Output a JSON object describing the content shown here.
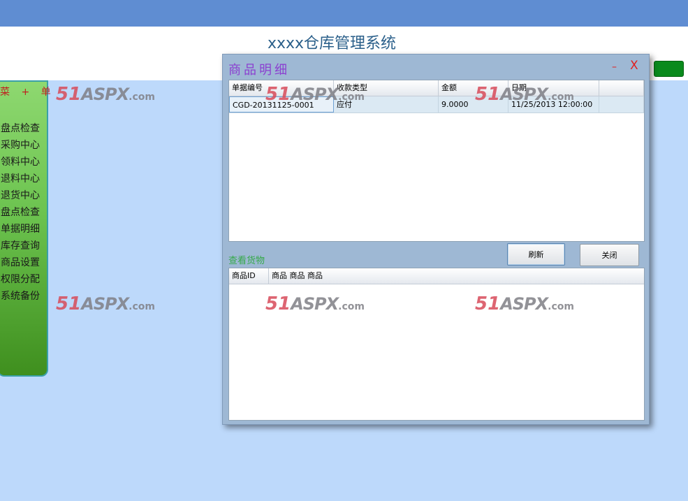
{
  "app": {
    "title": "xxxx仓库管理系统"
  },
  "sidebar": {
    "title": "菜 + 单",
    "items": [
      {
        "label": "盘点检查"
      },
      {
        "label": "采购中心"
      },
      {
        "label": "领料中心"
      },
      {
        "label": "退料中心"
      },
      {
        "label": "退货中心"
      },
      {
        "label": "盘点检查"
      },
      {
        "label": "单据明细"
      },
      {
        "label": "库存查询"
      },
      {
        "label": "商品设置"
      },
      {
        "label": "权限分配"
      },
      {
        "label": "系统备份"
      }
    ]
  },
  "watermark": {
    "num": "51",
    "text": "ASPX",
    "domain": ".com"
  },
  "dialog": {
    "title": "商品明细",
    "minimize_label": "–",
    "close_label": "X",
    "grid1": {
      "columns": [
        "单据编号",
        "收款类型",
        "金额",
        "日期",
        ""
      ],
      "rows": [
        [
          "CGD-20131125-0001",
          "应付",
          "9.0000",
          "11/25/2013 12:00:00",
          ""
        ]
      ]
    },
    "view_goods_label": "查看货物",
    "refresh_label": "刷新",
    "close_button_label": "关闭",
    "grid2": {
      "columns": [
        "商品ID",
        "商品 商品 商品"
      ]
    }
  }
}
